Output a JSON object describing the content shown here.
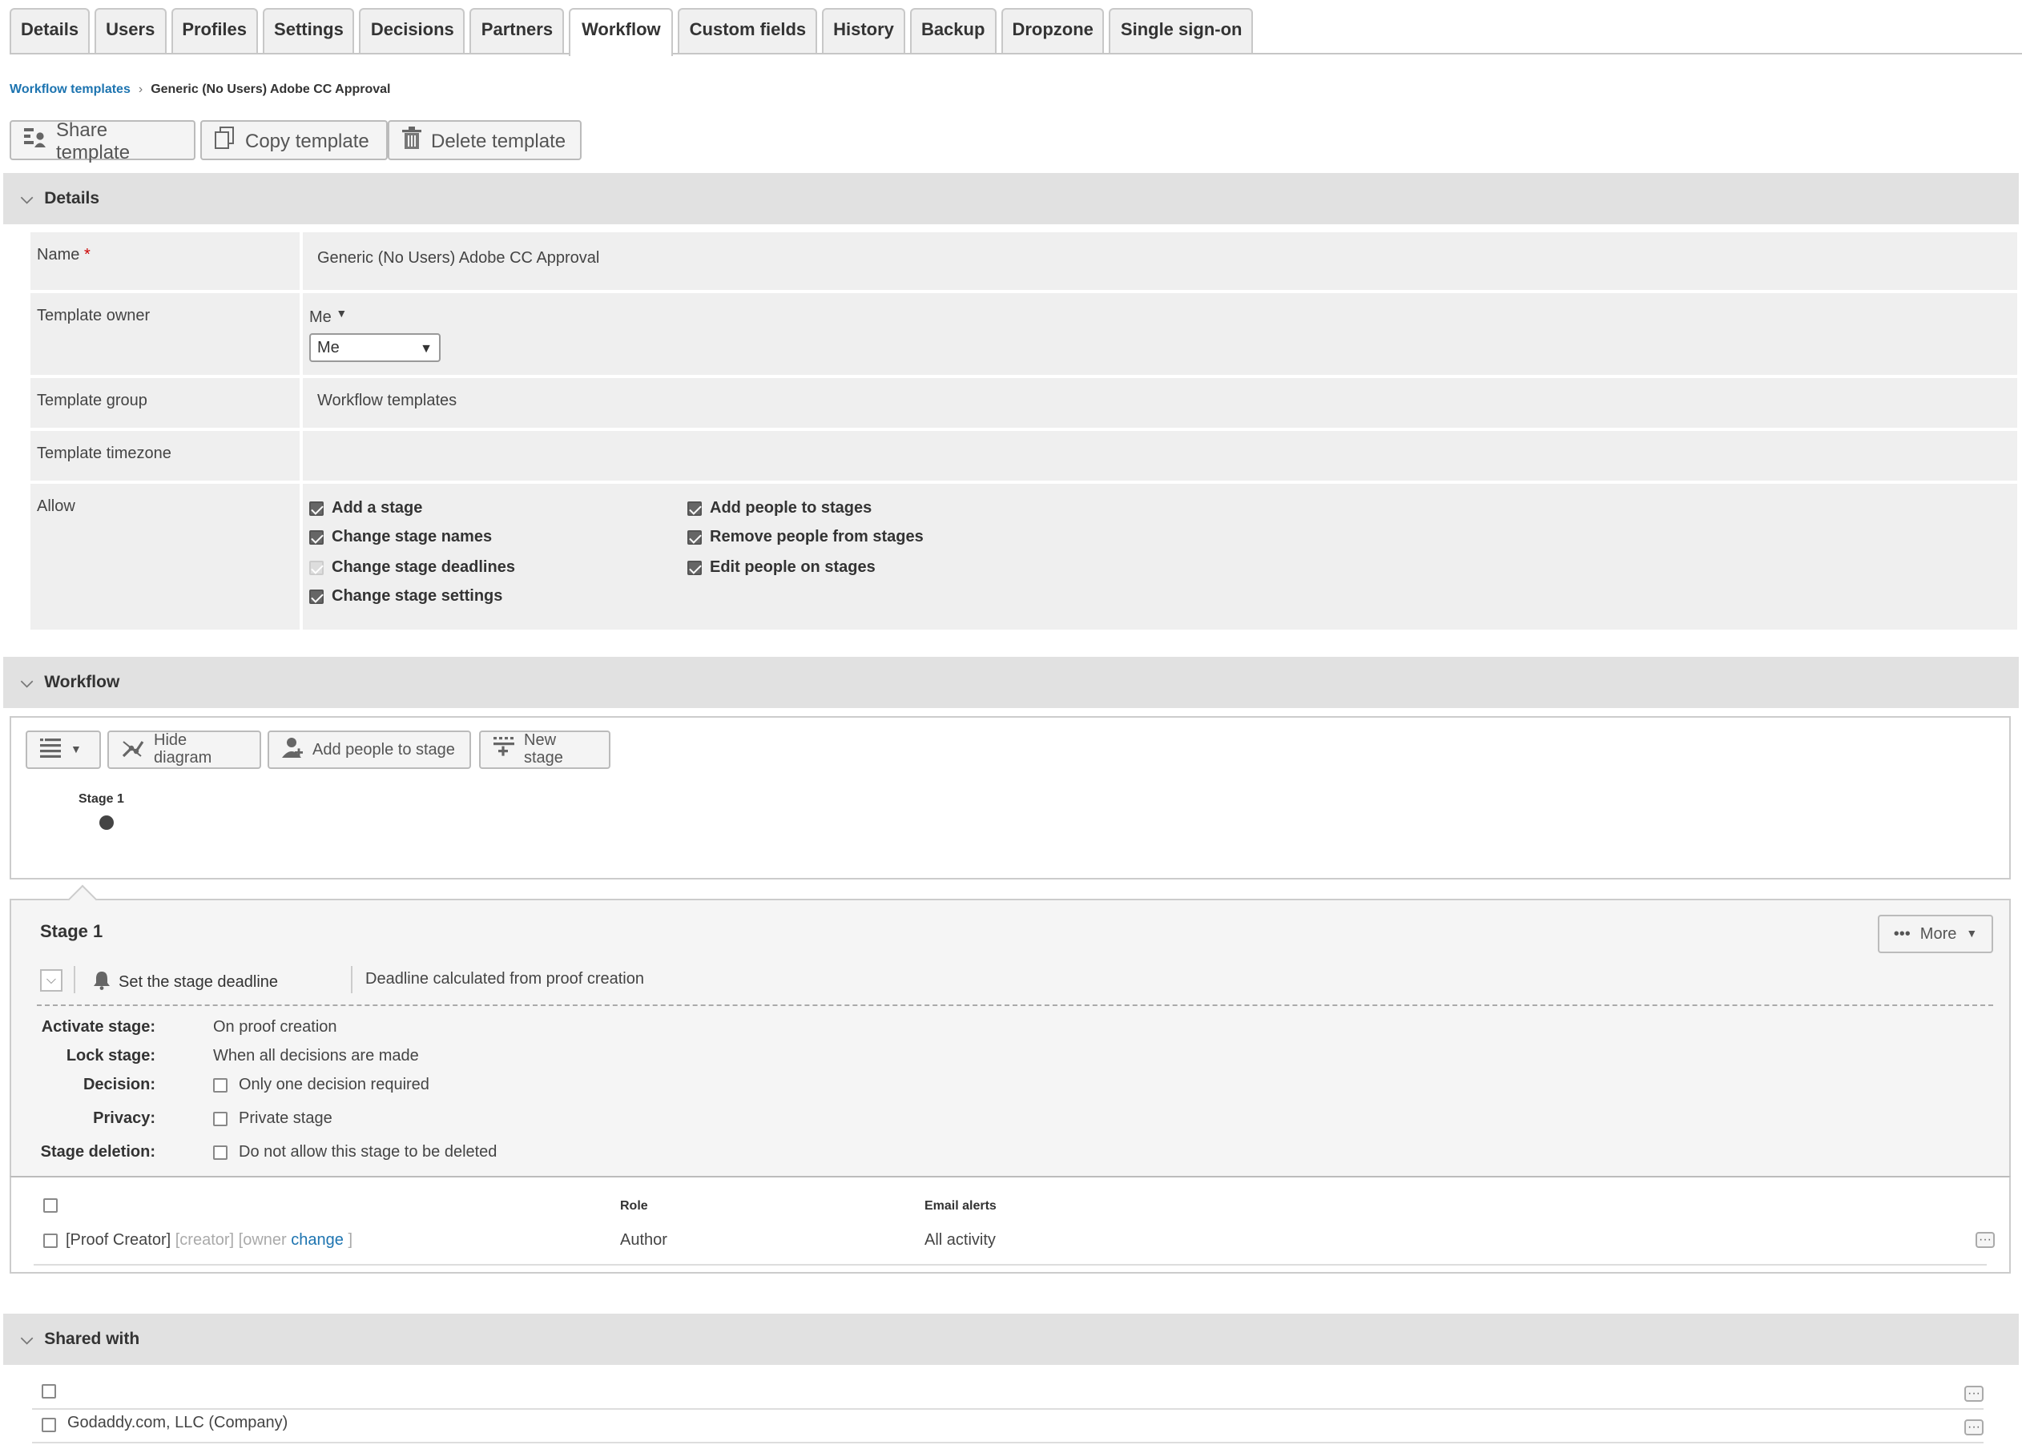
{
  "tabs": [
    "Details",
    "Users",
    "Profiles",
    "Settings",
    "Decisions",
    "Partners",
    "Workflow",
    "Custom fields",
    "History",
    "Backup",
    "Dropzone",
    "Single sign-on"
  ],
  "active_tab": "Workflow",
  "breadcrumb": {
    "parent": "Workflow templates",
    "current": "Generic (No Users) Adobe CC Approval"
  },
  "toolbar": {
    "share": "Share template",
    "copy": "Copy template",
    "delete": "Delete template"
  },
  "details": {
    "heading": "Details",
    "name_label": "Name",
    "required_mark": "*",
    "name_value": "Generic (No Users) Adobe CC Approval",
    "owner_label": "Template owner",
    "owner_text": "Me",
    "owner_select": "Me",
    "group_label": "Template group",
    "group_value": "Workflow templates",
    "timezone_label": "Template timezone",
    "timezone_value": "",
    "allow_label": "Allow",
    "allow": [
      {
        "label": "Add a stage",
        "state": "checked"
      },
      {
        "label": "Change stage names",
        "state": "checked"
      },
      {
        "label": "Change stage deadlines",
        "state": "disabled"
      },
      {
        "label": "Change stage settings",
        "state": "checked"
      },
      {
        "label": "Add people to stages",
        "state": "checked"
      },
      {
        "label": "Remove people from stages",
        "state": "checked"
      },
      {
        "label": "Edit people on stages",
        "state": "checked"
      }
    ]
  },
  "workflow": {
    "heading": "Workflow",
    "hide_diagram": "Hide diagram",
    "add_people": "Add people to stage",
    "new_stage": "New stage",
    "diagram_stage": "Stage 1"
  },
  "stage": {
    "title": "Stage 1",
    "more": "More",
    "set_deadline": "Set the stage deadline",
    "deadline_calc": "Deadline calculated from proof creation",
    "activate_label": "Activate stage:",
    "activate_value": "On proof creation",
    "lock_label": "Lock stage:",
    "lock_value": "When all decisions are made",
    "decision_label": "Decision:",
    "decision_value": "Only one decision required",
    "privacy_label": "Privacy:",
    "privacy_value": "Private stage",
    "deletion_label": "Stage deletion:",
    "deletion_value": "Do not allow this stage to be deleted"
  },
  "people": {
    "col_role": "Role",
    "col_email": "Email alerts",
    "rows": [
      {
        "name": "[Proof Creator]",
        "tags": "[creator] [owner",
        "change": "change",
        "tag_end": "]",
        "role": "Author",
        "email": "All activity"
      }
    ]
  },
  "shared": {
    "heading": "Shared with",
    "rows": [
      "",
      "Godaddy.com, LLC (Company)"
    ]
  }
}
